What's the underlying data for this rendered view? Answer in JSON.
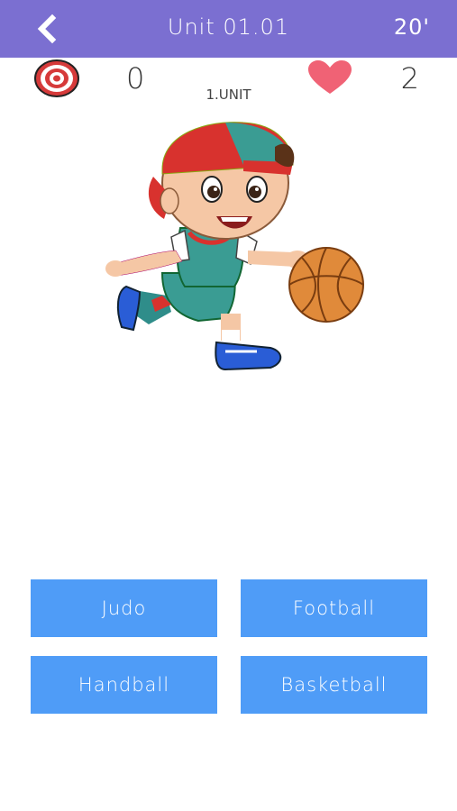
{
  "header": {
    "title": "Unit 01.01",
    "timer": "20'",
    "back_icon": "chevron-left-icon",
    "background_color": "#7b6fd1"
  },
  "stats": {
    "score": "0",
    "lives": "2",
    "unit_label": "1.UNIT",
    "score_icon": "target-icon",
    "lives_icon": "heart-icon",
    "heart_color": "#f06275"
  },
  "illustration": {
    "subject": "boy-playing-basketball-illustration"
  },
  "answers": [
    {
      "label": "Judo"
    },
    {
      "label": "Football"
    },
    {
      "label": "Handball"
    },
    {
      "label": "Basketball"
    }
  ],
  "colors": {
    "answer_button": "#4f9cf7"
  }
}
